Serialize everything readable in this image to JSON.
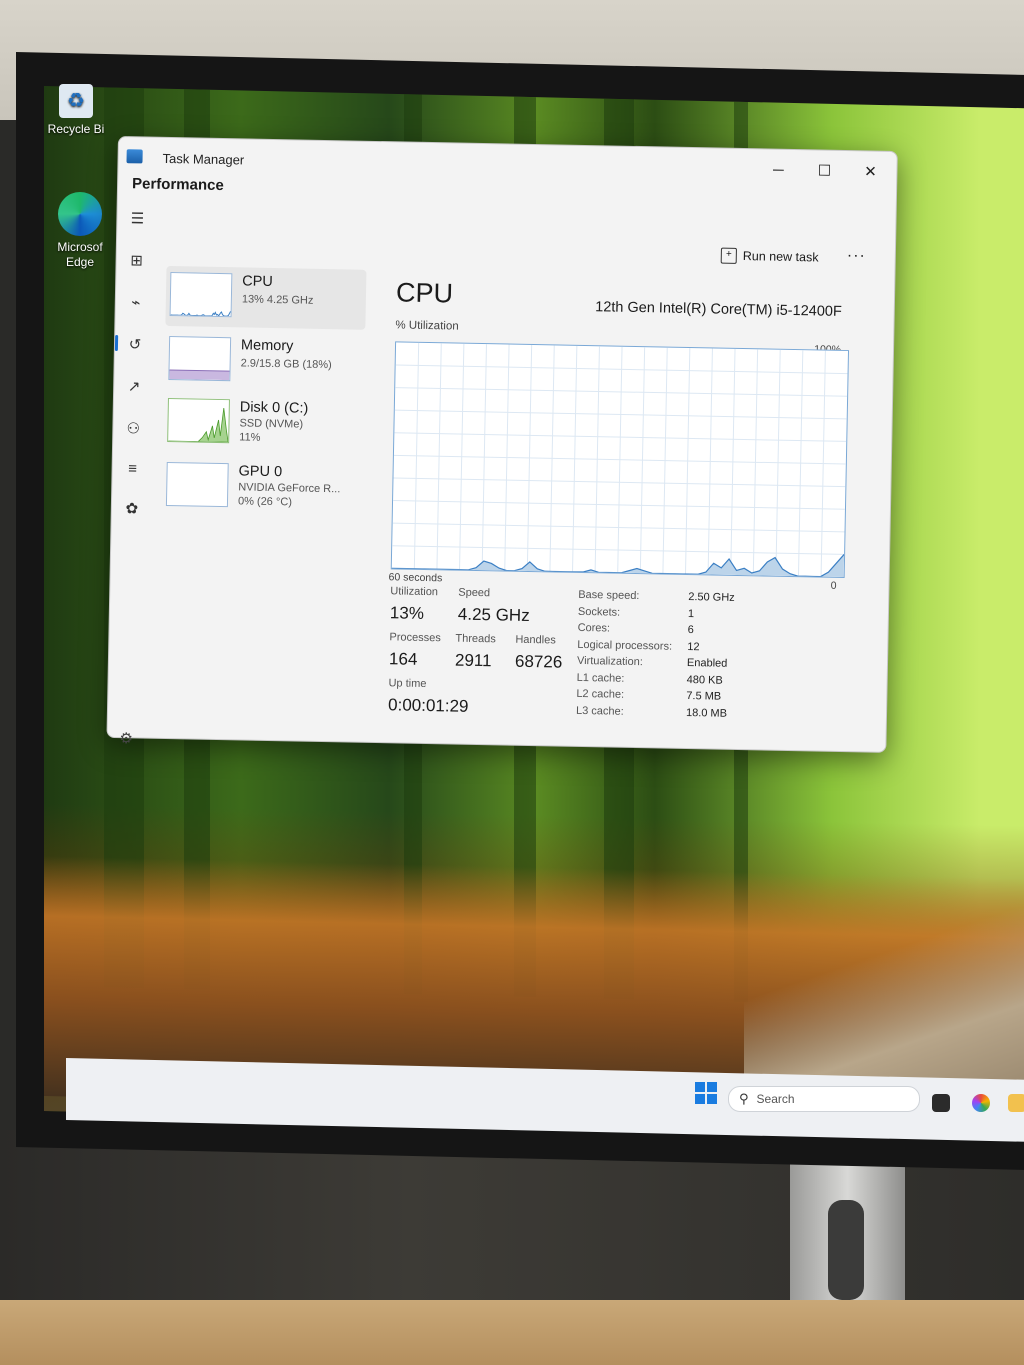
{
  "desktop": {
    "icons": [
      {
        "label": "Recycle Bi"
      },
      {
        "label": "Microsof Edge"
      }
    ]
  },
  "taskbar": {
    "search_placeholder": "Search"
  },
  "window": {
    "title": "Task Manager",
    "controls": {
      "minimize": "─",
      "maximize": "☐",
      "close": "✕"
    }
  },
  "header": {
    "page_title": "Performance",
    "run_new_task": "Run new task",
    "more": "···"
  },
  "resources": [
    {
      "name": "CPU",
      "line1": "13% 4.25 GHz",
      "line2": "",
      "selected": true
    },
    {
      "name": "Memory",
      "line1": "2.9/15.8 GB (18%)",
      "line2": ""
    },
    {
      "name": "Disk 0 (C:)",
      "line1": "SSD (NVMe)",
      "line2": "11%"
    },
    {
      "name": "GPU 0",
      "line1": "NVIDIA GeForce R...",
      "line2": "0% (26 °C)"
    }
  ],
  "detail": {
    "title": "CPU",
    "model": "12th Gen Intel(R) Core(TM) i5-12400F",
    "util_label": "% Utilization",
    "axis_max": "100%",
    "axis_left": "60 seconds",
    "axis_zero": "0",
    "stats": {
      "utilization_label": "Utilization",
      "utilization": "13%",
      "speed_label": "Speed",
      "speed": "4.25 GHz",
      "processes_label": "Processes",
      "processes": "164",
      "threads_label": "Threads",
      "threads": "2911",
      "handles_label": "Handles",
      "handles": "68726",
      "uptime_label": "Up time",
      "uptime": "0:00:01:29"
    },
    "specs": [
      {
        "key": "Base speed:",
        "value": "2.50 GHz"
      },
      {
        "key": "Sockets:",
        "value": "1"
      },
      {
        "key": "Cores:",
        "value": "6"
      },
      {
        "key": "Logical processors:",
        "value": "12"
      },
      {
        "key": "Virtualization:",
        "value": "Enabled"
      },
      {
        "key": "L1 cache:",
        "value": "480 KB"
      },
      {
        "key": "L2 cache:",
        "value": "7.5 MB"
      },
      {
        "key": "L3 cache:",
        "value": "18.0 MB"
      }
    ]
  },
  "cpu_history": [
    0,
    0,
    0,
    0,
    0,
    0,
    0,
    0,
    0,
    0,
    0,
    1,
    4,
    3,
    1,
    0,
    0,
    1,
    4,
    1,
    0,
    0,
    0,
    0,
    0,
    0,
    1,
    0,
    0,
    0,
    0,
    1,
    2,
    1,
    0,
    0,
    0,
    0,
    0,
    0,
    0,
    1,
    5,
    3,
    7,
    2,
    3,
    1,
    2,
    6,
    8,
    3,
    1,
    0,
    0,
    0,
    0,
    2,
    6,
    10
  ],
  "colors": {
    "accent": "#1a6fd1",
    "graph_fill": "#bcd4ea",
    "graph_line": "#3b7fc4"
  }
}
